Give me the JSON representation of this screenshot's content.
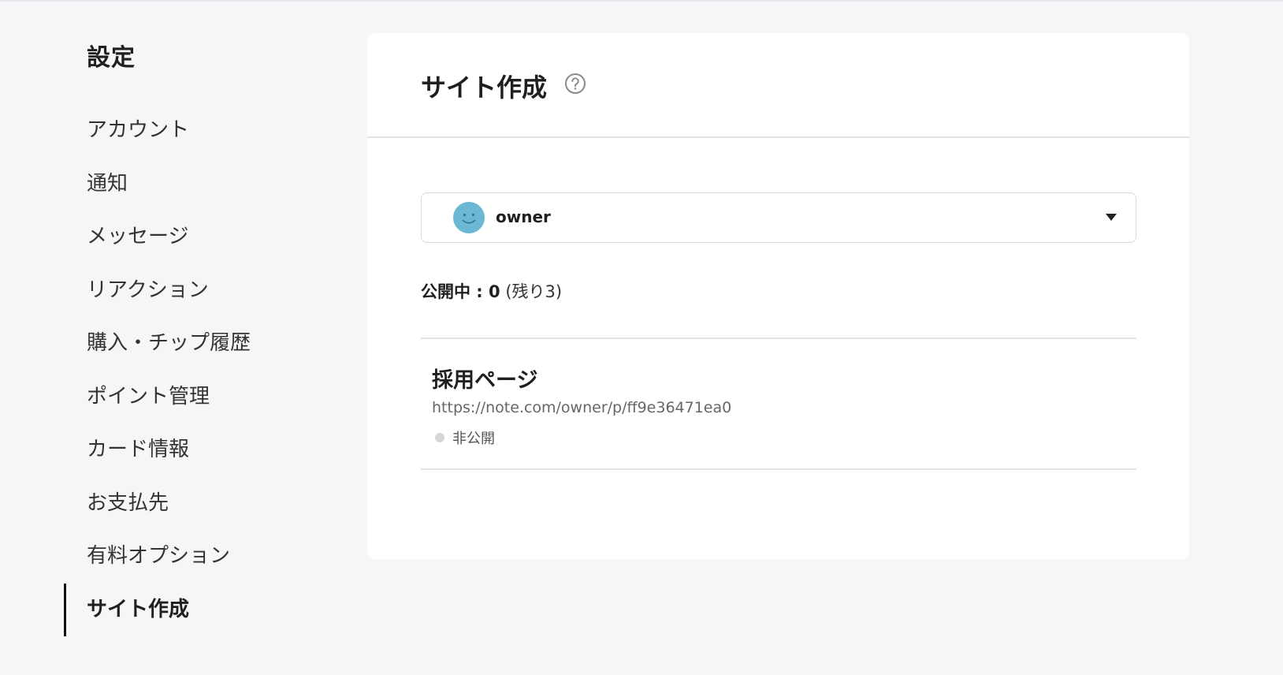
{
  "sidebar": {
    "title": "設定",
    "items": [
      {
        "label": "アカウント"
      },
      {
        "label": "通知"
      },
      {
        "label": "メッセージ"
      },
      {
        "label": "リアクション"
      },
      {
        "label": "購入・チップ履歴"
      },
      {
        "label": "ポイント管理"
      },
      {
        "label": "カード情報"
      },
      {
        "label": "お支払先"
      },
      {
        "label": "有料オプション"
      },
      {
        "label": "サイト作成"
      }
    ],
    "active_item": "サイト作成"
  },
  "main": {
    "title": "サイト作成",
    "help_icon": "question-circle-icon",
    "account_select": {
      "value": "owner",
      "avatar_icon": "smiley-avatar",
      "avatar_color": "#6cb8d3",
      "caret_icon": "caret-down-icon"
    },
    "status": {
      "label": "公開中 : 0",
      "remaining": "(残り3)"
    },
    "sites": [
      {
        "name": "採用ページ",
        "url": "https://note.com/owner/p/ff9e36471ea0",
        "visibility": "非公開",
        "visibility_color": "#d5d6d9"
      }
    ]
  }
}
